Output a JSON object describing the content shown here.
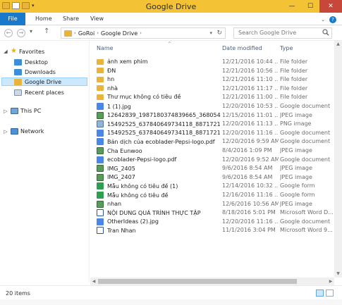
{
  "window": {
    "title": "Google Drive",
    "controls": {
      "minimize": "—",
      "maximize": "☐",
      "close": "✕"
    },
    "qat_arrow": "▾"
  },
  "ribbon": {
    "tabs": [
      "File",
      "Home",
      "Share",
      "View"
    ],
    "expand_icon": "⌄",
    "help_icon": "?"
  },
  "navigation": {
    "back": "←",
    "forward": "→",
    "recent": "▾",
    "up": "↑",
    "breadcrumb": [
      "GoRoi",
      "Google Drive"
    ],
    "separator": "›",
    "dropdown": "▾",
    "refresh": "↻"
  },
  "search": {
    "placeholder": "Search Google Drive"
  },
  "sidebar": {
    "favorites_label": "Favorites",
    "favorites_items": [
      {
        "label": "Desktop",
        "icon": "desktop-icon"
      },
      {
        "label": "Downloads",
        "icon": "downloads-icon"
      },
      {
        "label": "Google Drive",
        "icon": "google-drive-folder-icon",
        "selected": true
      },
      {
        "label": "Recent places",
        "icon": "recent-places-icon"
      }
    ],
    "this_pc_label": "This PC",
    "network_label": "Network"
  },
  "columns": {
    "name": "Name",
    "date": "Date modified",
    "type": "Type",
    "sort_indicator": "^"
  },
  "files": [
    {
      "name": "ảnh xem phim",
      "date": "12/21/2016 10:44 ...",
      "type": "File folder",
      "kind": "folder"
    },
    {
      "name": "ĐN",
      "date": "12/21/2016 10:56 ...",
      "type": "File folder",
      "kind": "folder"
    },
    {
      "name": "hn",
      "date": "12/21/2016 11:10 ...",
      "type": "File folder",
      "kind": "folder"
    },
    {
      "name": "nhà",
      "date": "12/21/2016 11:17 ...",
      "type": "File folder",
      "kind": "folder"
    },
    {
      "name": "Thư mục không có tiêu đề",
      "date": "12/21/2016 11:00 ...",
      "type": "File folder",
      "kind": "folder"
    },
    {
      "name": "1 (1).jpg",
      "date": "12/20/2016 10:53 ...",
      "type": "Google document",
      "kind": "gdoc"
    },
    {
      "name": "12642839_1987180374839665_3680540744...",
      "date": "12/15/2016 11:01 ...",
      "type": "JPEG image",
      "kind": "image"
    },
    {
      "name": "15492525_637840649734118_88717219113...",
      "date": "12/20/2016 11:13 ...",
      "type": "PNG image",
      "kind": "png"
    },
    {
      "name": "15492525_637840649734118_88717219113...",
      "date": "12/20/2016 11:16 ...",
      "type": "Google document",
      "kind": "gdoc"
    },
    {
      "name": "Bản dịch của ecoblader-Pepsi-logo.pdf",
      "date": "12/20/2016 9:59 AM",
      "type": "Google document",
      "kind": "gdoc"
    },
    {
      "name": "Cha Eunwoo",
      "date": "8/4/2016 1:09 PM",
      "type": "JPEG image",
      "kind": "image"
    },
    {
      "name": "ecoblader-Pepsi-logo.pdf",
      "date": "12/20/2016 9:52 AM",
      "type": "Google document",
      "kind": "gdoc"
    },
    {
      "name": "IMG_2405",
      "date": "9/6/2016 8:54 AM",
      "type": "JPEG image",
      "kind": "image"
    },
    {
      "name": "IMG_2407",
      "date": "9/6/2016 8:54 AM",
      "type": "JPEG image",
      "kind": "image"
    },
    {
      "name": "Mẫu không có tiêu đề (1)",
      "date": "12/14/2016 10:32 ...",
      "type": "Google form",
      "kind": "form"
    },
    {
      "name": "Mẫu không có tiêu đề",
      "date": "12/16/2016 11:16 ...",
      "type": "Google form",
      "kind": "form"
    },
    {
      "name": "nhan",
      "date": "12/6/2016 10:56 AM",
      "type": "JPEG image",
      "kind": "image"
    },
    {
      "name": "NỘI DUNG QUÁ TRÌNH THỰC TẬP",
      "date": "8/18/2016 5:01 PM",
      "type": "Microsoft Word D...",
      "kind": "word"
    },
    {
      "name": "OtherIdeas (2).jpg",
      "date": "12/20/2016 11:16 ...",
      "type": "Google document",
      "kind": "gdoc"
    },
    {
      "name": "Tran Nhan",
      "date": "11/1/2016 3:04 PM",
      "type": "Microsoft Word 9...",
      "kind": "word"
    }
  ],
  "scroll": {
    "up": "▲",
    "down": "▼",
    "left": "◀",
    "right": "▶"
  },
  "status": {
    "item_count": "20 items"
  },
  "colors": {
    "titlebar": "#f4c335",
    "accent": "#1979ca",
    "selection": "#cce8ff"
  }
}
